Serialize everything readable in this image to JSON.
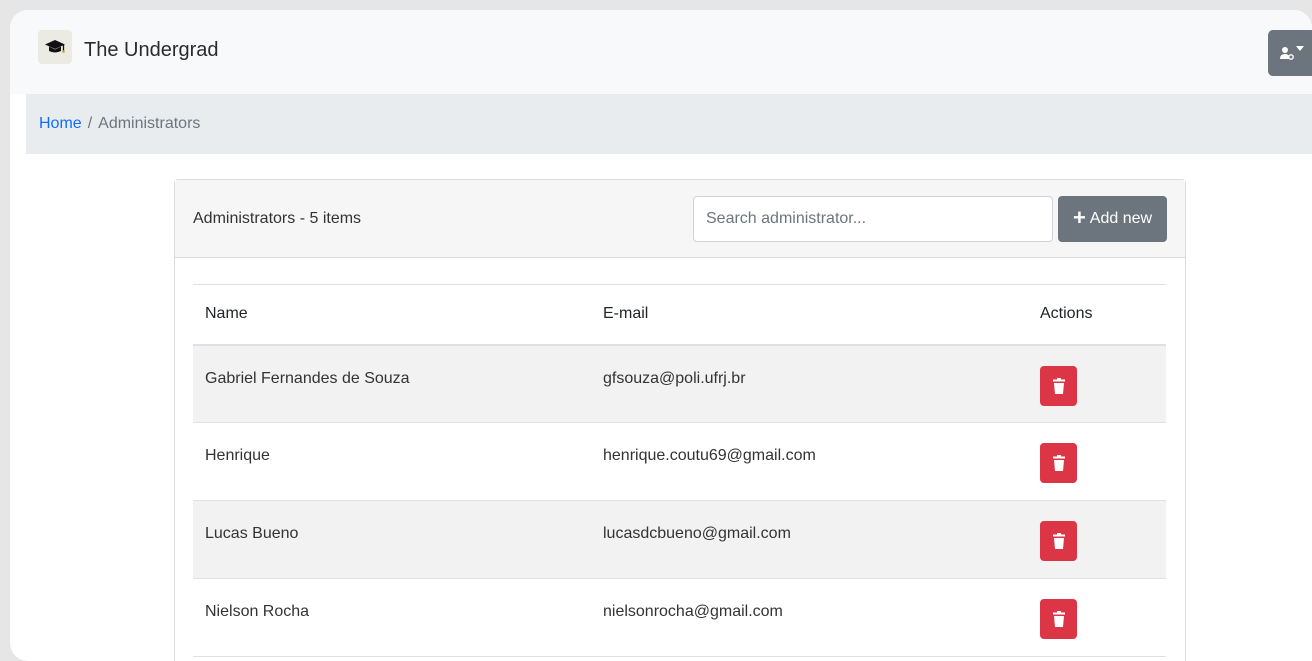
{
  "app": {
    "brand": "The Undergrad"
  },
  "breadcrumb": {
    "home": "Home",
    "separator": "/",
    "current": "Administrators"
  },
  "card": {
    "title": "Administrators - 5 items",
    "search_placeholder": "Search administrator...",
    "add_label": "Add new"
  },
  "table": {
    "columns": [
      "Name",
      "E-mail",
      "Actions"
    ],
    "rows": [
      {
        "name": "Gabriel Fernandes de Souza",
        "email": "gfsouza@poli.ufrj.br"
      },
      {
        "name": "Henrique",
        "email": "henrique.coutu69@gmail.com"
      },
      {
        "name": "Lucas Bueno",
        "email": "lucasdcbueno@gmail.com"
      },
      {
        "name": "Nielson Rocha",
        "email": "nielsonrocha@gmail.com"
      }
    ]
  },
  "icons": {
    "brand": "graduation-cap-icon",
    "user": "user-gear-icon",
    "add": "plus-icon",
    "delete": "trash-icon"
  },
  "colors": {
    "danger": "#dc3545",
    "secondary": "#6c757d",
    "link": "#0d6efd"
  }
}
